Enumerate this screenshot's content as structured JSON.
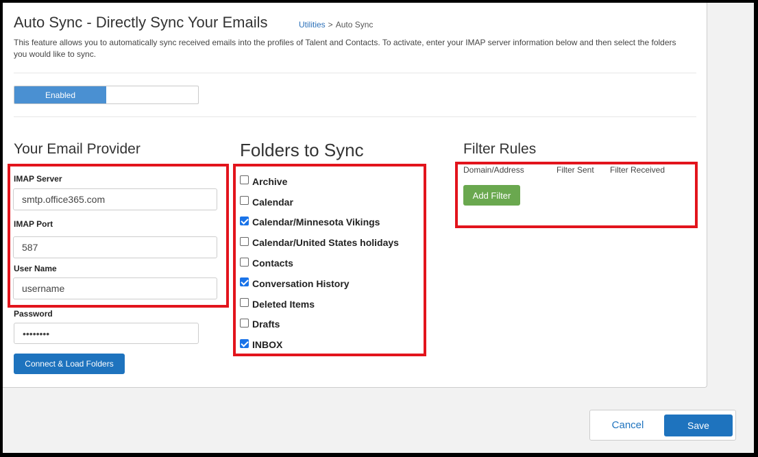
{
  "header": {
    "title": "Auto Sync - Directly Sync Your Emails",
    "breadcrumb_link": "Utilities",
    "breadcrumb_sep": ">",
    "breadcrumb_current": "Auto Sync",
    "description": "This feature allows you to automatically sync received emails into the profiles of Talent and Contacts. To activate, enter your IMAP server information below and then select the folders you would like to sync."
  },
  "toggle": {
    "label": "Enabled",
    "state": "on"
  },
  "provider": {
    "title": "Your Email Provider",
    "imap_server_label": "IMAP Server",
    "imap_server_value": "smtp.office365.com",
    "imap_port_label": "IMAP Port",
    "imap_port_value": "587",
    "username_label": "User Name",
    "username_value": "username",
    "password_label": "Password",
    "password_value": "••••••••",
    "connect_label": "Connect & Load Folders"
  },
  "folders": {
    "title": "Folders to Sync",
    "items": [
      {
        "label": "Archive",
        "checked": false
      },
      {
        "label": "Calendar",
        "checked": false
      },
      {
        "label": "Calendar/Minnesota Vikings",
        "checked": true
      },
      {
        "label": "Calendar/United States holidays",
        "checked": false
      },
      {
        "label": "Contacts",
        "checked": false
      },
      {
        "label": "Conversation History",
        "checked": true
      },
      {
        "label": "Deleted Items",
        "checked": false
      },
      {
        "label": "Drafts",
        "checked": false
      },
      {
        "label": "INBOX",
        "checked": true
      }
    ]
  },
  "filters": {
    "title": "Filter Rules",
    "col_domain": "Domain/Address",
    "col_sent": "Filter Sent",
    "col_received": "Filter Received",
    "add_label": "Add Filter"
  },
  "footer": {
    "cancel_label": "Cancel",
    "save_label": "Save"
  },
  "colors": {
    "primary": "#1e73be",
    "toggle_on": "#4a90d2",
    "add_filter": "#6aa84f",
    "highlight_box": "#e2141c"
  }
}
